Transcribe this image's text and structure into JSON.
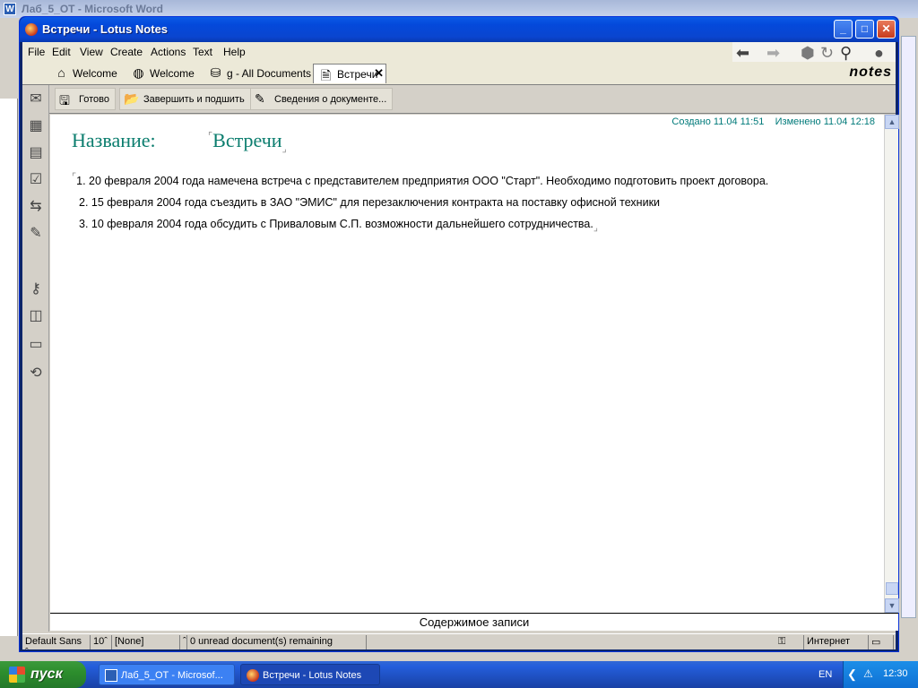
{
  "background_window": {
    "title": "Лаб_5_ОТ - Microsoft Word"
  },
  "window": {
    "title": "Встречи - Lotus Notes"
  },
  "menu": [
    "File",
    "Edit",
    "View",
    "Create",
    "Actions",
    "Text",
    "Help"
  ],
  "tabs": [
    {
      "label": "Welcome",
      "icon": "home-icon"
    },
    {
      "label": "Welcome",
      "icon": "globe-icon"
    },
    {
      "label": "g - All Documents",
      "icon": "database-icon"
    },
    {
      "label": "Встречи",
      "icon": "document-icon",
      "active": true
    }
  ],
  "logo": "notes",
  "actions": [
    {
      "label": "Готово",
      "icon": "save-icon"
    },
    {
      "label": "Завершить и подшить",
      "icon": "file-folder-icon"
    },
    {
      "label": "Сведения о документе...",
      "icon": "edit-info-icon"
    }
  ],
  "document": {
    "created": "Создано 11.04 11:51",
    "modified": "Изменено 11.04 12:18",
    "field_label": "Название:",
    "title": "Встречи",
    "items": [
      "1. 20 февраля 2004 года намечена встреча с представителем предприятия ООО \"Старт\". Необходимо подготовить проект договора.",
      "2. 15 февраля 2004 года съездить в ЗАО \"ЭМИС\" для перезаключения контракта на поставку офисной техники",
      "3.  10 февраля 2004 года обсудить с Приваловым С.П. возможности дальнейшего сотрудничества."
    ]
  },
  "field_title": "Содержимое записи",
  "status": {
    "font": "Default Sans",
    "size": "10",
    "style": "[None]",
    "unread": "0 unread document(s) remaining",
    "zone": "Интернет"
  },
  "taskbar": {
    "start": "пуск",
    "tasks": [
      {
        "label": "Лаб_5_ОТ - Microsof..."
      },
      {
        "label": "Встречи - Lotus Notes"
      }
    ],
    "lang": "EN",
    "clock": "12:30"
  },
  "colors": {
    "accent": "#0b7d6e",
    "meta": "#007a7a",
    "titlebar": "#0449db"
  }
}
